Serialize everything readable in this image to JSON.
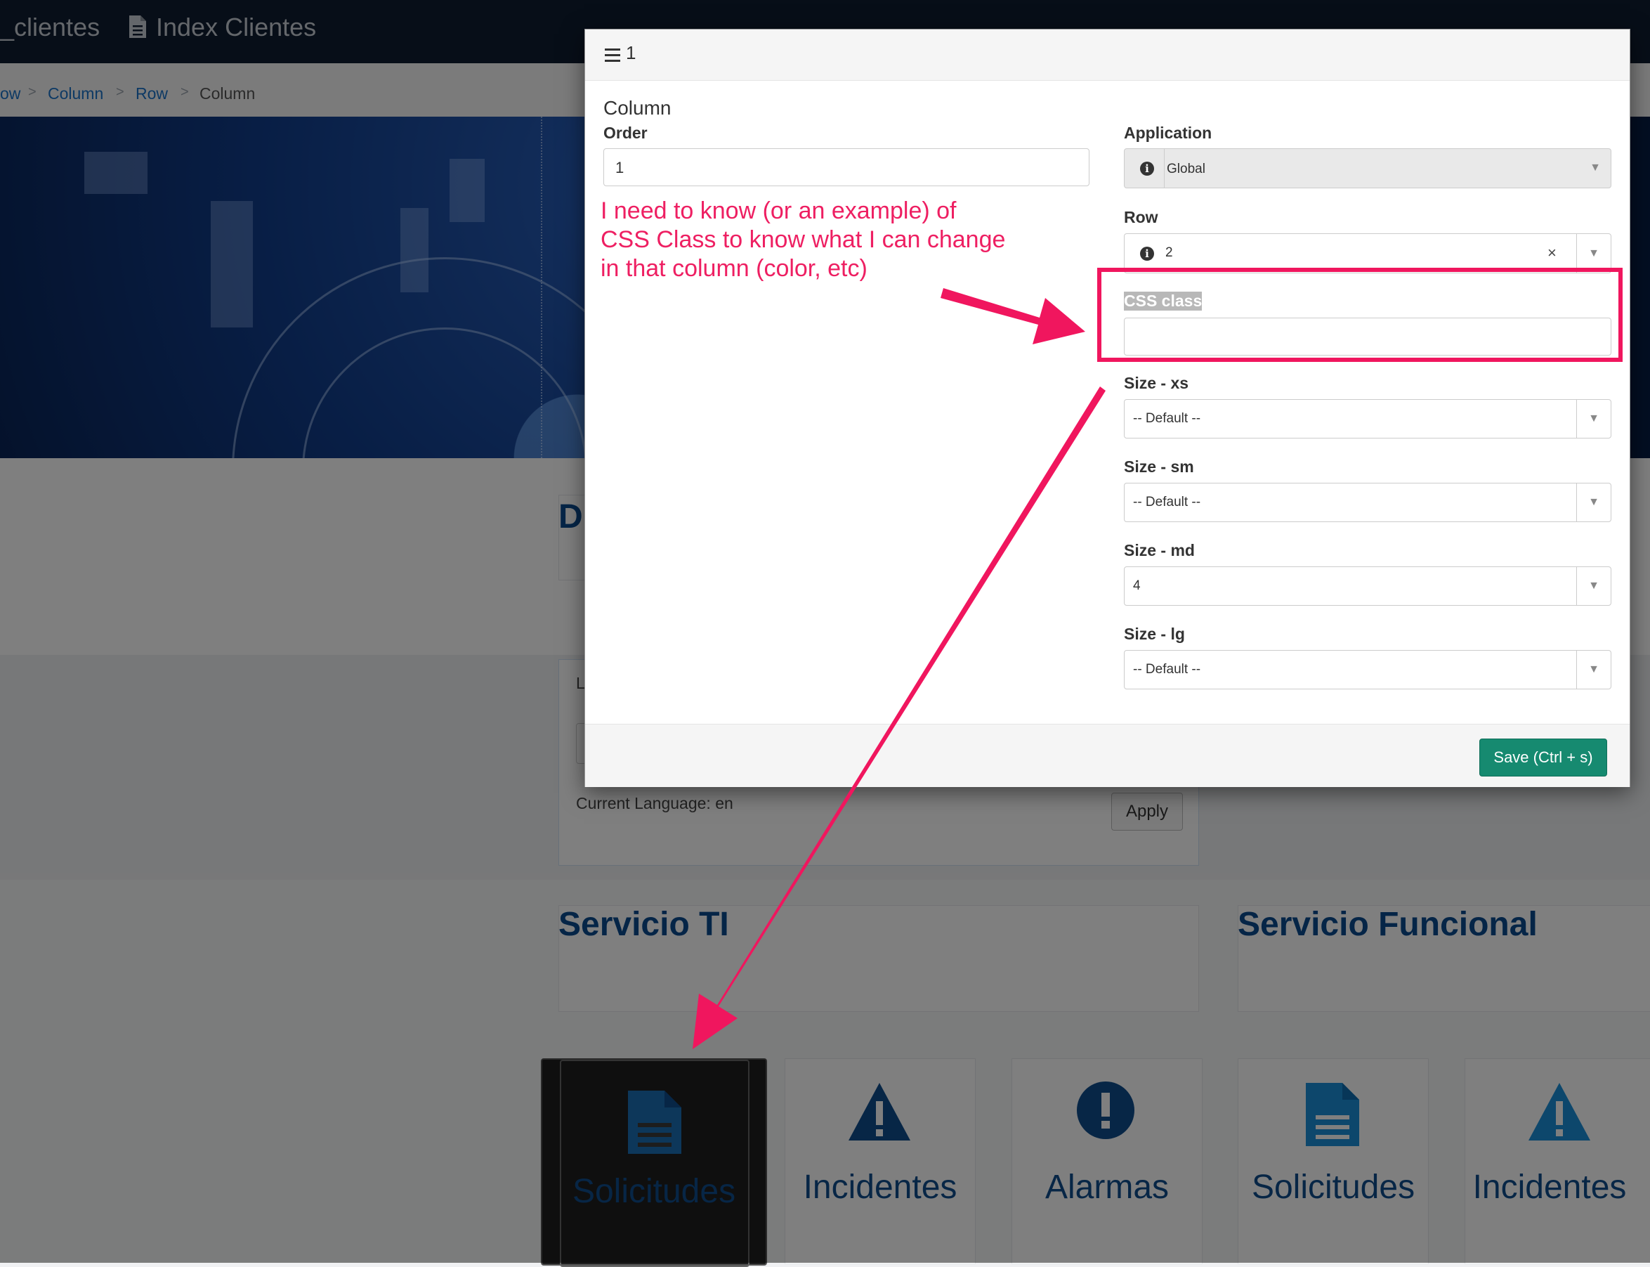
{
  "topbar": {
    "app_title": "_clientes",
    "page_title": "Index Clientes"
  },
  "breadcrumb": {
    "items": [
      "ow",
      "Column",
      "Row",
      "Column"
    ],
    "separator": ">"
  },
  "background": {
    "language_label": "Current Language: en",
    "apply_label": "Apply",
    "partial_heading": "D",
    "partial_label": "L",
    "service_ti": "Servicio TI",
    "service_funcional": "Servicio Funcional",
    "tiles": [
      {
        "label": "Solicitudes",
        "icon": "document-icon"
      },
      {
        "label": "Incidentes",
        "icon": "warning-icon"
      },
      {
        "label": "Alarmas",
        "icon": "exclamation-icon"
      },
      {
        "label": "Solicitudes",
        "icon": "document-icon"
      },
      {
        "label": "Incidentes",
        "icon": "warning-icon"
      }
    ]
  },
  "modal": {
    "title": "1",
    "section_title": "Column",
    "order": {
      "label": "Order",
      "value": "1"
    },
    "application": {
      "label": "Application",
      "value": "Global"
    },
    "row": {
      "label": "Row",
      "value": "2",
      "clear": "×"
    },
    "css_class": {
      "label": "CSS class",
      "value": ""
    },
    "size_xs": {
      "label": "Size - xs",
      "value": "-- Default --"
    },
    "size_sm": {
      "label": "Size - sm",
      "value": "-- Default --"
    },
    "size_md": {
      "label": "Size - md",
      "value": "4"
    },
    "size_lg": {
      "label": "Size - lg",
      "value": "-- Default --"
    },
    "save_label": "Save  (Ctrl + s)"
  },
  "annotation": {
    "line1": "I need to know (or an example) of",
    "line2": "CSS Class to know what I can change",
    "line3": "in that column (color, etc)"
  },
  "colors": {
    "accent": "#f0165e",
    "save": "#168a70",
    "heading": "#0b4a8f"
  }
}
